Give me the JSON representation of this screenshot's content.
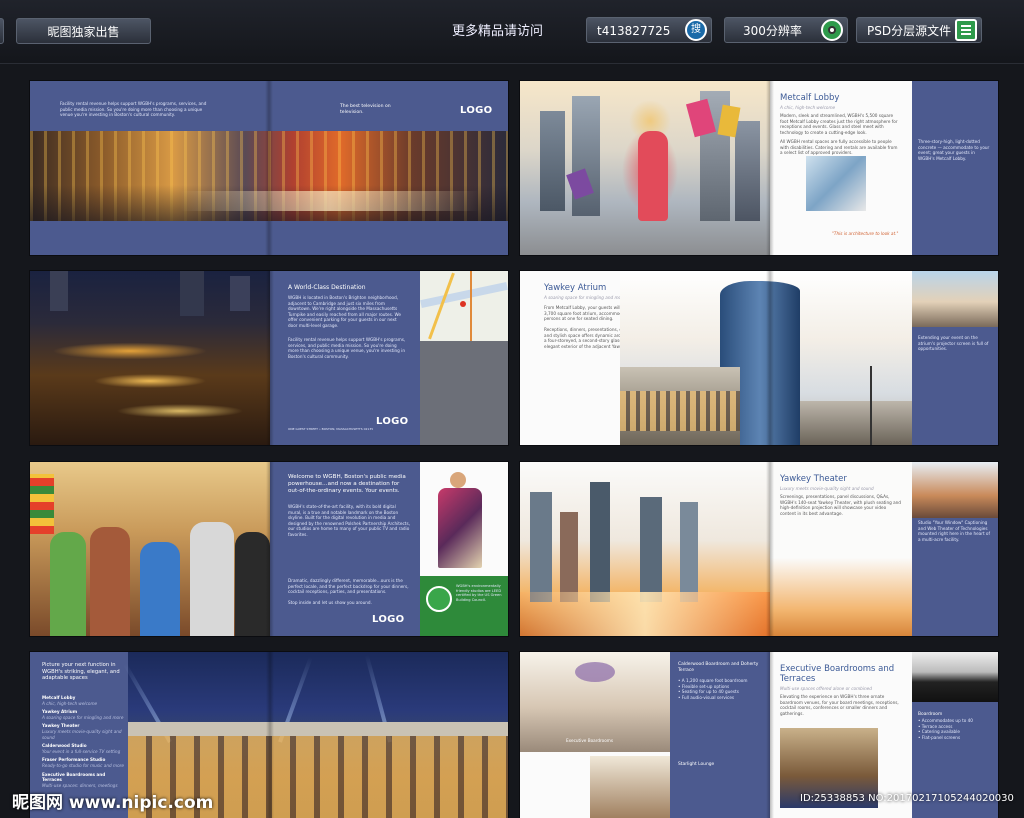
{
  "header": {
    "exclusive_label": "昵图独家出售",
    "more_text": "更多精品请访问",
    "qq": "t413827725",
    "search_label": "搜",
    "resolution": "300分辨率",
    "psd_label": "PSD分层源文件"
  },
  "spread1": {
    "intro": "Facility rental revenue helps support WGBH's programs, services, and public media mission. So you're doing more than choosing a unique venue you're investing in Boston's cultural community.",
    "tagline": "The best television on television.",
    "logo": "LOGO"
  },
  "spread2": {
    "title": "Metcalf Lobby",
    "subtitle": "A chic, high-tech welcome",
    "body": "Modern, sleek and streamlined, WGBH's 5,500 square foot Metcalf Lobby creates just the right atmosphere for receptions and events. Glass and steel meet with technology to create a cutting-edge look.",
    "body2": "All WGBH rental spaces are fully accessible to people with disabilities. Catering and rentals are available from a select list of approved providers.",
    "quote": "\"This is architecture to look at.\"",
    "side": "Three-story-high, light-dotted concrete — accommodate to your event; great your guests in WGBH's Metcalf Lobby."
  },
  "spread3": {
    "title": "A World-Class Destination",
    "body": "WGBH is located in Boston's Brighton neighborhood, adjacent to Cambridge and just six miles from downtown. We're right alongside the Massachusetts Turnpike and easily reached from all major routes. We offer convenient parking for your guests in our next door multi-level garage.",
    "body2": "Facility rental revenue helps support WGBH's programs, services, and public media mission. So you're doing more than choosing a unique venue, you're investing in Boston's cultural community.",
    "address": "ONE GUEST STREET  •  BOSTON, MASSACHUSETTS 02135",
    "logo": "LOGO"
  },
  "spread4": {
    "title": "Yawkey Atrium",
    "subtitle": "A soaring space for mingling and more",
    "body": "From Metcalf Lobby, your guests will enter WGBH's 3,700 square foot atrium, accommodating up to 250 persons at one for seated dining.",
    "body2": "Receptions, dinners, presentations, drinks – the flexible and stylish space offers dynamic architectural features: a four-storeyed, a second-story glass footbridge, the top-elegant exterior of the adjacent Yawkey Theater.",
    "side": "Extending your event on the atrium's projector screen is full of opportunities."
  },
  "spread5": {
    "title": "Welcome to WGBH, Boston's public media powerhouse…and now a destination for out-of-the-ordinary events. Your events.",
    "body": "WGBH's state-of-the-art facility, with its bold digital mural, is a true and notable landmark on the Boston skyline. Built for the digital revolution in media and designed by the renowned Polshek Partnership Architects, our studios are home to many of your public TV and radio favorites.",
    "body2": "Dramatic, dazzlingly different, memorable…ours is the perfect locale, and the perfect backdrop for your dinners, cocktail receptions, parties, and presentations.",
    "body3": "Stop inside and let us show you around.",
    "badge": "WGBH's environmentally friendly studios are LEED certified by the US Green Building Council.",
    "logo": "LOGO"
  },
  "spread6": {
    "title": "Yawkey Theater",
    "subtitle": "Luxury meets movie-quality sight and sound",
    "body": "Screenings, presentations, panel discussions, Q&As, WGBH's 140-seat Yawkey Theater, with plush seating and high-definition projection will showcase your video content in its best advantage.",
    "side": "Studio \"Your Window\" Captioning and Web Theater of Technologies mounted right here in the heart of a multi-acre facility."
  },
  "spread7": {
    "intro": "Picture your next function in WGBH's striking, elegant, and adaptable spaces",
    "items": [
      {
        "name": "Metcalf Lobby",
        "desc": "A chic, high-tech welcome"
      },
      {
        "name": "Yawkey Atrium",
        "desc": "A soaring space for mingling and more"
      },
      {
        "name": "Yawkey Theater",
        "desc": "Luxury meets movie-quality sight and sound"
      },
      {
        "name": "Calderwood Studio",
        "desc": "Your event in a full-service TV setting"
      },
      {
        "name": "Fraser Performance Studio",
        "desc": "Ready-to-go studio for music and more"
      },
      {
        "name": "Executive Boardrooms and Terraces",
        "desc": "Multi-use spaces: dinners, meetings"
      }
    ]
  },
  "spread8": {
    "caption": "Executive Boardrooms",
    "right_title": "Calderwood Boardroom and Doherty Terrace",
    "bullets": [
      "A 1,200 square foot boardroom",
      "Flexible set-up options",
      "Seating for up to 40 guests",
      "Full audio-visual services"
    ],
    "section2": "Starlight Lounge",
    "title": "Executive Boardrooms and Terraces",
    "subtitle": "Multi-use spaces offered alone or combined",
    "body": "Elevating the experience on WGBH's three ornate boardroom venues, for your board meetings, receptions, cocktail rooms, conferences or smaller dinners and gatherings.",
    "side_title": "Boardroom",
    "side_bullets": [
      "Accommodates up to 40",
      "Terrace access",
      "Catering available",
      "Flat-panel screens"
    ]
  },
  "watermark": {
    "left": "昵图网 www.nipic.com",
    "right": "ID:25338853 NO:20170217105244020030"
  }
}
